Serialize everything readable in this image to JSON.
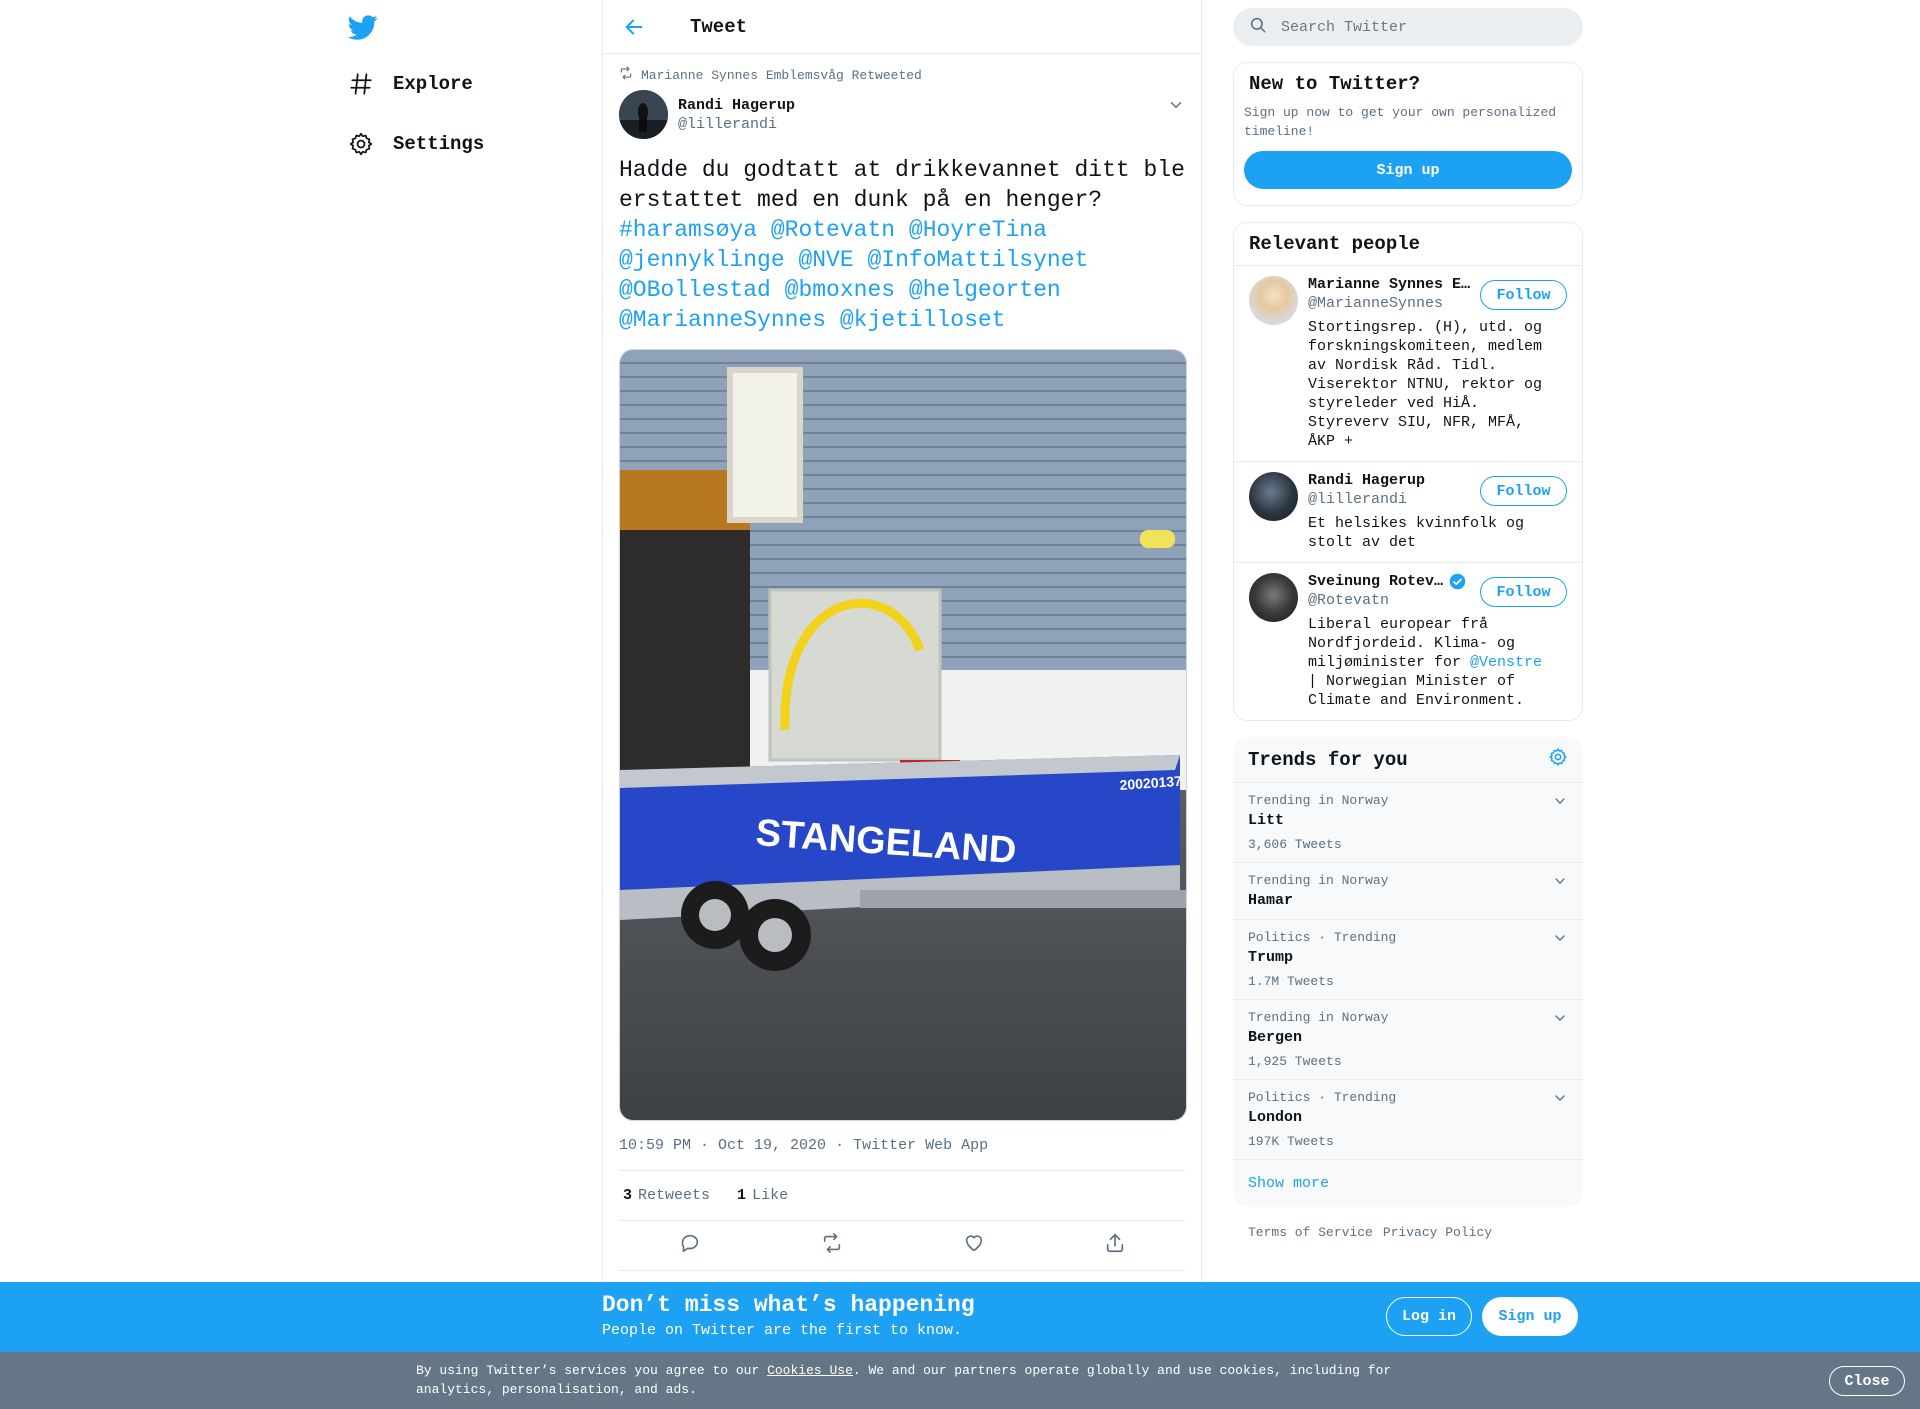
{
  "nav": {
    "explore_label": "Explore",
    "settings_label": "Settings"
  },
  "header": {
    "title": "Tweet"
  },
  "tweet": {
    "retweeted_by": "Marianne Synnes Emblemsvåg Retweeted",
    "author_name": "Randi Hagerup",
    "author_handle": "@lillerandi",
    "text_plain": "Hadde du godtatt at drikkevannet ditt ble erstattet med en dunk på en henger?",
    "text_links": [
      "#haramsøya",
      "@Rotevatn",
      "@HoyreTina",
      "@jennyklinge",
      "@NVE",
      "@InfoMattilsynet",
      "@OBollestad",
      "@bmoxnes",
      "@helgeorten",
      "@MarianneSynnes",
      "@kjetilloset"
    ],
    "image_texts": [
      "STANGELAND",
      "20020137"
    ],
    "time": "10:59 PM · Oct 19, 2020",
    "source": "Twitter Web App",
    "retweets_count": "3",
    "retweets_label": "Retweets",
    "likes_count": "1",
    "likes_label": "Like"
  },
  "search": {
    "placeholder": "Search Twitter"
  },
  "new_to_twitter": {
    "title": "New to Twitter?",
    "subtitle": "Sign up now to get your own personalized timeline!",
    "button": "Sign up"
  },
  "relevant_people": {
    "title": "Relevant people",
    "follow_label": "Follow",
    "people": [
      {
        "name": "Marianne Synnes E…",
        "handle": "@MarianneSynnes",
        "bio": "Stortingsrep. (H), utd. og forskningskomiteen, medlem av Nordisk Råd. Tidl. Viserektor NTNU, rektor og styreleder ved HiÅ. Styreverv SIU, NFR, MFÅ, ÅKP +"
      },
      {
        "name": "Randi Hagerup",
        "handle": "@lillerandi",
        "bio": "Et helsikes kvinnfolk og stolt av det"
      },
      {
        "name": "Sveinung Rotev…",
        "handle": "@Rotevatn",
        "bio_before": "Liberal europear frå Nordfjordeid. Klima- og miljøminister for ",
        "bio_link": "@Venstre",
        "bio_after": " | Norwegian Minister of Climate and Environment."
      }
    ]
  },
  "trends": {
    "title": "Trends for you",
    "items": [
      {
        "category": "Trending in Norway",
        "name": "Litt",
        "count": "3,606 Tweets"
      },
      {
        "category": "Trending in Norway",
        "name": "Hamar",
        "count": ""
      },
      {
        "category": "Politics · Trending",
        "name": "Trump",
        "count": "1.7M Tweets"
      },
      {
        "category": "Trending in Norway",
        "name": "Bergen",
        "count": "1,925 Tweets"
      },
      {
        "category": "Politics · Trending",
        "name": "London",
        "count": "197K Tweets"
      }
    ],
    "show_more": "Show more"
  },
  "footer": {
    "terms": "Terms of Service",
    "privacy": "Privacy Policy"
  },
  "banner": {
    "title": "Don’t miss what’s happening",
    "subtitle": "People on Twitter are the first to know.",
    "login": "Log in",
    "signup": "Sign up"
  },
  "cookie": {
    "before": "By using Twitter’s services you agree to our ",
    "link": "Cookies Use",
    "after": ". We and our partners operate globally and use cookies, including for analytics, personalisation, and ads.",
    "close": "Close"
  },
  "colors": {
    "accent": "#1da1f2",
    "text": "#0f1419",
    "muted": "#5b7083",
    "cookie_bg": "#657786"
  },
  "icons": [
    "twitter-bird-icon",
    "hashtag-icon",
    "gear-icon",
    "back-arrow-icon",
    "retweet-icon",
    "chevron-down-icon",
    "search-icon",
    "reply-icon",
    "like-icon",
    "share-icon",
    "verified-icon"
  ]
}
